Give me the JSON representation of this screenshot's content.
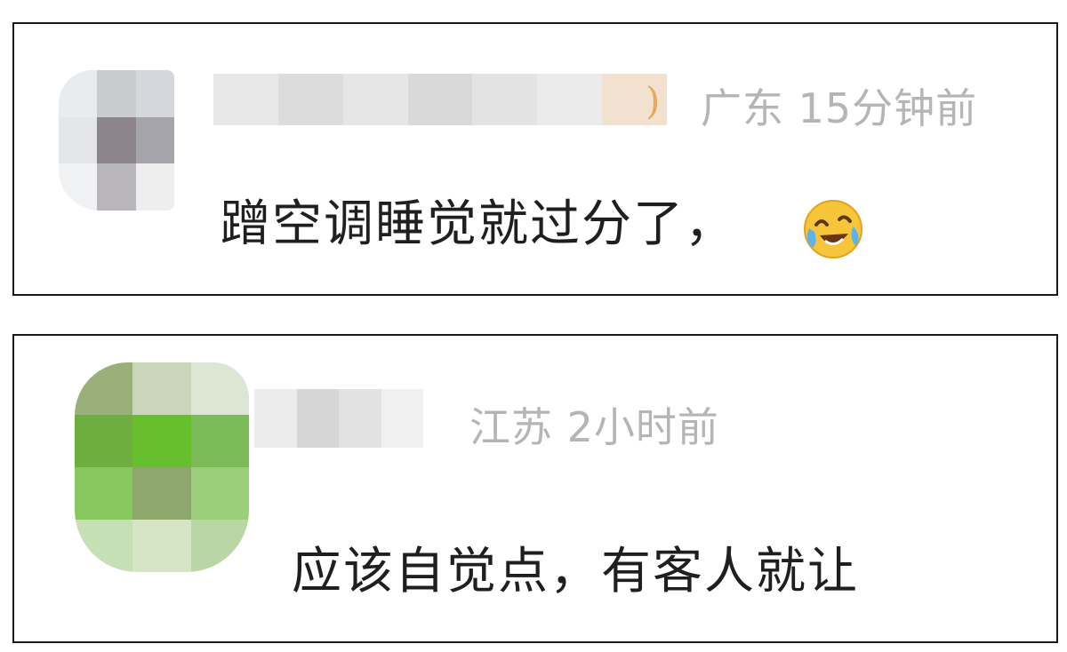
{
  "comments": [
    {
      "location": "广东",
      "time": "15分钟前",
      "text": "蹭空调睡觉就过分了，",
      "emoji": "laughing-crying-emoji"
    },
    {
      "location": "江苏",
      "time": "2小时前",
      "text": "应该自觉点，有客人就让"
    }
  ],
  "colors": {
    "meta_text": "#b5b5b5",
    "comment_text": "#1f1f1f",
    "card_border": "#1a1a1a",
    "badge_orange": "#e9a65d"
  }
}
